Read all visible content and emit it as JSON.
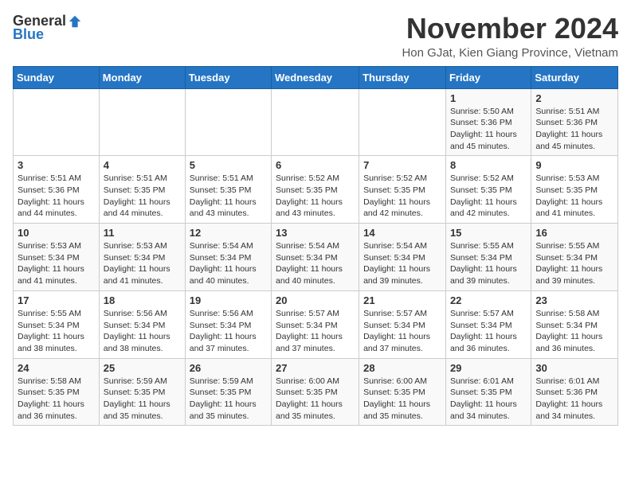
{
  "header": {
    "logo_general": "General",
    "logo_blue": "Blue",
    "month_title": "November 2024",
    "location": "Hon GJat, Kien Giang Province, Vietnam"
  },
  "days_of_week": [
    "Sunday",
    "Monday",
    "Tuesday",
    "Wednesday",
    "Thursday",
    "Friday",
    "Saturday"
  ],
  "weeks": [
    [
      {
        "day": "",
        "info": ""
      },
      {
        "day": "",
        "info": ""
      },
      {
        "day": "",
        "info": ""
      },
      {
        "day": "",
        "info": ""
      },
      {
        "day": "",
        "info": ""
      },
      {
        "day": "1",
        "info": "Sunrise: 5:50 AM\nSunset: 5:36 PM\nDaylight: 11 hours and 45 minutes."
      },
      {
        "day": "2",
        "info": "Sunrise: 5:51 AM\nSunset: 5:36 PM\nDaylight: 11 hours and 45 minutes."
      }
    ],
    [
      {
        "day": "3",
        "info": "Sunrise: 5:51 AM\nSunset: 5:36 PM\nDaylight: 11 hours and 44 minutes."
      },
      {
        "day": "4",
        "info": "Sunrise: 5:51 AM\nSunset: 5:35 PM\nDaylight: 11 hours and 44 minutes."
      },
      {
        "day": "5",
        "info": "Sunrise: 5:51 AM\nSunset: 5:35 PM\nDaylight: 11 hours and 43 minutes."
      },
      {
        "day": "6",
        "info": "Sunrise: 5:52 AM\nSunset: 5:35 PM\nDaylight: 11 hours and 43 minutes."
      },
      {
        "day": "7",
        "info": "Sunrise: 5:52 AM\nSunset: 5:35 PM\nDaylight: 11 hours and 42 minutes."
      },
      {
        "day": "8",
        "info": "Sunrise: 5:52 AM\nSunset: 5:35 PM\nDaylight: 11 hours and 42 minutes."
      },
      {
        "day": "9",
        "info": "Sunrise: 5:53 AM\nSunset: 5:35 PM\nDaylight: 11 hours and 41 minutes."
      }
    ],
    [
      {
        "day": "10",
        "info": "Sunrise: 5:53 AM\nSunset: 5:34 PM\nDaylight: 11 hours and 41 minutes."
      },
      {
        "day": "11",
        "info": "Sunrise: 5:53 AM\nSunset: 5:34 PM\nDaylight: 11 hours and 41 minutes."
      },
      {
        "day": "12",
        "info": "Sunrise: 5:54 AM\nSunset: 5:34 PM\nDaylight: 11 hours and 40 minutes."
      },
      {
        "day": "13",
        "info": "Sunrise: 5:54 AM\nSunset: 5:34 PM\nDaylight: 11 hours and 40 minutes."
      },
      {
        "day": "14",
        "info": "Sunrise: 5:54 AM\nSunset: 5:34 PM\nDaylight: 11 hours and 39 minutes."
      },
      {
        "day": "15",
        "info": "Sunrise: 5:55 AM\nSunset: 5:34 PM\nDaylight: 11 hours and 39 minutes."
      },
      {
        "day": "16",
        "info": "Sunrise: 5:55 AM\nSunset: 5:34 PM\nDaylight: 11 hours and 39 minutes."
      }
    ],
    [
      {
        "day": "17",
        "info": "Sunrise: 5:55 AM\nSunset: 5:34 PM\nDaylight: 11 hours and 38 minutes."
      },
      {
        "day": "18",
        "info": "Sunrise: 5:56 AM\nSunset: 5:34 PM\nDaylight: 11 hours and 38 minutes."
      },
      {
        "day": "19",
        "info": "Sunrise: 5:56 AM\nSunset: 5:34 PM\nDaylight: 11 hours and 37 minutes."
      },
      {
        "day": "20",
        "info": "Sunrise: 5:57 AM\nSunset: 5:34 PM\nDaylight: 11 hours and 37 minutes."
      },
      {
        "day": "21",
        "info": "Sunrise: 5:57 AM\nSunset: 5:34 PM\nDaylight: 11 hours and 37 minutes."
      },
      {
        "day": "22",
        "info": "Sunrise: 5:57 AM\nSunset: 5:34 PM\nDaylight: 11 hours and 36 minutes."
      },
      {
        "day": "23",
        "info": "Sunrise: 5:58 AM\nSunset: 5:34 PM\nDaylight: 11 hours and 36 minutes."
      }
    ],
    [
      {
        "day": "24",
        "info": "Sunrise: 5:58 AM\nSunset: 5:35 PM\nDaylight: 11 hours and 36 minutes."
      },
      {
        "day": "25",
        "info": "Sunrise: 5:59 AM\nSunset: 5:35 PM\nDaylight: 11 hours and 35 minutes."
      },
      {
        "day": "26",
        "info": "Sunrise: 5:59 AM\nSunset: 5:35 PM\nDaylight: 11 hours and 35 minutes."
      },
      {
        "day": "27",
        "info": "Sunrise: 6:00 AM\nSunset: 5:35 PM\nDaylight: 11 hours and 35 minutes."
      },
      {
        "day": "28",
        "info": "Sunrise: 6:00 AM\nSunset: 5:35 PM\nDaylight: 11 hours and 35 minutes."
      },
      {
        "day": "29",
        "info": "Sunrise: 6:01 AM\nSunset: 5:35 PM\nDaylight: 11 hours and 34 minutes."
      },
      {
        "day": "30",
        "info": "Sunrise: 6:01 AM\nSunset: 5:36 PM\nDaylight: 11 hours and 34 minutes."
      }
    ]
  ]
}
